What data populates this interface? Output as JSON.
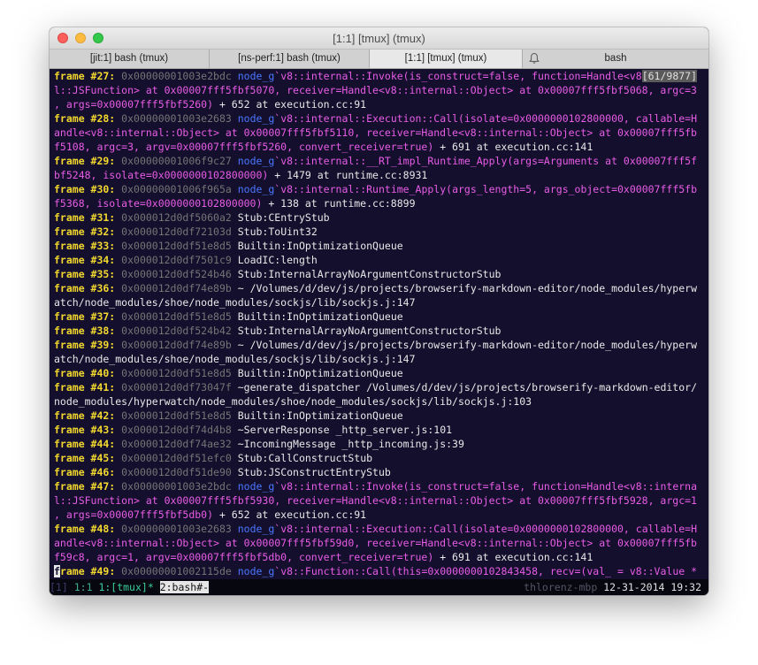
{
  "window": {
    "title": "[1:1] [tmux] (tmux)"
  },
  "tabs": [
    {
      "label": "[jit:1] bash (tmux)"
    },
    {
      "label": "[ns-perf:1] bash (tmux)"
    },
    {
      "label": "[1:1] [tmux] (tmux)"
    },
    {
      "label": "bash",
      "icon": "bell-icon"
    }
  ],
  "terminal": {
    "scroll_position": "[61/9877]",
    "lines": [
      [
        [
          "frame #27:",
          "lbl"
        ],
        [
          " 0x00000001003e2bdc ",
          "addr"
        ],
        [
          "node_g",
          "nodeg"
        ],
        [
          "`v8::internal::Invoke(is_construct=false, function=Handle<v8",
          "pink"
        ]
      ],
      [
        [
          "l::JSFunction> at 0x00007fff5fbf5070, receiver=Handle<v8::internal::Object> at 0x00007fff5fbf5068, argc=3",
          "pink"
        ]
      ],
      [
        [
          ", args=0x00007fff5fbf5260)",
          "pink"
        ],
        [
          " + 652 at execution.cc:91",
          "plain"
        ]
      ],
      [
        [
          "frame #28:",
          "lbl"
        ],
        [
          " 0x00000001003e2683 ",
          "addr"
        ],
        [
          "node_g",
          "nodeg"
        ],
        [
          "`v8::internal::Execution::Call(isolate=0x0000000102800000, callable=H",
          "pink"
        ]
      ],
      [
        [
          "andle<v8::internal::Object> at 0x00007fff5fbf5110, receiver=Handle<v8::internal::Object> at 0x00007fff5fb",
          "pink"
        ]
      ],
      [
        [
          "f5108, argc=3, argv=0x00007fff5fbf5260, convert_receiver=true)",
          "pink"
        ],
        [
          " + 691 at execution.cc:141",
          "plain"
        ]
      ],
      [
        [
          "frame #29:",
          "lbl"
        ],
        [
          " 0x00000001006f9c27 ",
          "addr"
        ],
        [
          "node_g",
          "nodeg"
        ],
        [
          "`v8::internal::__RT_impl_Runtime_Apply(args=Arguments at 0x00007fff5f",
          "pink"
        ]
      ],
      [
        [
          "bf5248, isolate=0x0000000102800000)",
          "pink"
        ],
        [
          " + 1479 at runtime.cc:8931",
          "plain"
        ]
      ],
      [
        [
          "frame #30:",
          "lbl"
        ],
        [
          " 0x00000001006f965a ",
          "addr"
        ],
        [
          "node_g",
          "nodeg"
        ],
        [
          "`v8::internal::Runtime_Apply(args_length=5, args_object=0x00007fff5fb",
          "pink"
        ]
      ],
      [
        [
          "f5368, isolate=0x0000000102800000)",
          "pink"
        ],
        [
          " + 138 at runtime.cc:8899",
          "plain"
        ]
      ],
      [
        [
          "frame #31:",
          "lbl"
        ],
        [
          " 0x000012d0df5060a2 ",
          "addr"
        ],
        [
          "Stub:CEntryStub",
          "plain"
        ]
      ],
      [
        [
          "frame #32:",
          "lbl"
        ],
        [
          " 0x000012d0df72103d ",
          "addr"
        ],
        [
          "Stub:ToUint32",
          "plain"
        ]
      ],
      [
        [
          "frame #33:",
          "lbl"
        ],
        [
          " 0x000012d0df51e8d5 ",
          "addr"
        ],
        [
          "Builtin:InOptimizationQueue",
          "plain"
        ]
      ],
      [
        [
          "frame #34:",
          "lbl"
        ],
        [
          " 0x000012d0df7501c9 ",
          "addr"
        ],
        [
          "LoadIC:length",
          "plain"
        ]
      ],
      [
        [
          "frame #35:",
          "lbl"
        ],
        [
          " 0x000012d0df524b46 ",
          "addr"
        ],
        [
          "Stub:InternalArrayNoArgumentConstructorStub",
          "plain"
        ]
      ],
      [
        [
          "frame #36:",
          "lbl"
        ],
        [
          " 0x000012d0df74e89b ",
          "addr"
        ],
        [
          "~ /Volumes/d/dev/js/projects/browserify-markdown-editor/node_modules/hyperw",
          "plain"
        ]
      ],
      [
        [
          "atch/node_modules/shoe/node_modules/sockjs/lib/sockjs.j:147",
          "plain"
        ]
      ],
      [
        [
          "frame #37:",
          "lbl"
        ],
        [
          " 0x000012d0df51e8d5 ",
          "addr"
        ],
        [
          "Builtin:InOptimizationQueue",
          "plain"
        ]
      ],
      [
        [
          "frame #38:",
          "lbl"
        ],
        [
          " 0x000012d0df524b42 ",
          "addr"
        ],
        [
          "Stub:InternalArrayNoArgumentConstructorStub",
          "plain"
        ]
      ],
      [
        [
          "frame #39:",
          "lbl"
        ],
        [
          " 0x000012d0df74e89b ",
          "addr"
        ],
        [
          "~ /Volumes/d/dev/js/projects/browserify-markdown-editor/node_modules/hyperw",
          "plain"
        ]
      ],
      [
        [
          "atch/node_modules/shoe/node_modules/sockjs/lib/sockjs.j:147",
          "plain"
        ]
      ],
      [
        [
          "frame #40:",
          "lbl"
        ],
        [
          " 0x000012d0df51e8d5 ",
          "addr"
        ],
        [
          "Builtin:InOptimizationQueue",
          "plain"
        ]
      ],
      [
        [
          "frame #41:",
          "lbl"
        ],
        [
          " 0x000012d0df73047f ",
          "addr"
        ],
        [
          "~generate_dispatcher /Volumes/d/dev/js/projects/browserify-markdown-editor/",
          "plain"
        ]
      ],
      [
        [
          "node_modules/hyperwatch/node_modules/shoe/node_modules/sockjs/lib/sockjs.j:103",
          "plain"
        ]
      ],
      [
        [
          "frame #42:",
          "lbl"
        ],
        [
          " 0x000012d0df51e8d5 ",
          "addr"
        ],
        [
          "Builtin:InOptimizationQueue",
          "plain"
        ]
      ],
      [
        [
          "frame #43:",
          "lbl"
        ],
        [
          " 0x000012d0df74d4b8 ",
          "addr"
        ],
        [
          "~ServerResponse _http_server.js:101",
          "plain"
        ]
      ],
      [
        [
          "frame #44:",
          "lbl"
        ],
        [
          " 0x000012d0df74ae32 ",
          "addr"
        ],
        [
          "~IncomingMessage _http_incoming.js:39",
          "plain"
        ]
      ],
      [
        [
          "frame #45:",
          "lbl"
        ],
        [
          " 0x000012d0df51efc0 ",
          "addr"
        ],
        [
          "Stub:CallConstructStub",
          "plain"
        ]
      ],
      [
        [
          "frame #46:",
          "lbl"
        ],
        [
          " 0x000012d0df51de90 ",
          "addr"
        ],
        [
          "Stub:JSConstructEntryStub",
          "plain"
        ]
      ],
      [
        [
          "frame #47:",
          "lbl"
        ],
        [
          " 0x00000001003e2bdc ",
          "addr"
        ],
        [
          "node_g",
          "nodeg"
        ],
        [
          "`v8::internal::Invoke(is_construct=false, function=Handle<v8::interna",
          "pink"
        ]
      ],
      [
        [
          "l::JSFunction> at 0x00007fff5fbf5930, receiver=Handle<v8::internal::Object> at 0x00007fff5fbf5928, argc=1",
          "pink"
        ]
      ],
      [
        [
          ", args=0x00007fff5fbf5db0)",
          "pink"
        ],
        [
          " + 652 at execution.cc:91",
          "plain"
        ]
      ],
      [
        [
          "frame #48:",
          "lbl"
        ],
        [
          " 0x00000001003e2683 ",
          "addr"
        ],
        [
          "node_g",
          "nodeg"
        ],
        [
          "`v8::internal::Execution::Call(isolate=0x0000000102800000, callable=H",
          "pink"
        ]
      ],
      [
        [
          "andle<v8::internal::Object> at 0x00007fff5fbf59d0, receiver=Handle<v8::internal::Object> at 0x00007fff5fb",
          "pink"
        ]
      ],
      [
        [
          "f59c8, argc=1, argv=0x00007fff5fbf5db0, convert_receiver=true)",
          "pink"
        ],
        [
          " + 691 at execution.cc:141",
          "plain"
        ]
      ],
      [
        [
          "f",
          "lbl cursor"
        ],
        [
          "rame #49:",
          "lbl"
        ],
        [
          " 0x00000001002115de ",
          "addr"
        ],
        [
          "node_g",
          "nodeg"
        ],
        [
          "`v8::Function::Call(this=0x0000000102843458, recv=(val_ = v8::Value *",
          "pink"
        ]
      ]
    ]
  },
  "status_bar": {
    "session": "[1]",
    "pane": "1:1",
    "window_1": "1:[tmux]*",
    "window_2": "2:bash#-",
    "host": "thlorenz-mbp",
    "date": "12-31-2014",
    "time": "19:32"
  },
  "colors": {
    "terminal_bg": "#140f2d",
    "frame_label": "#f3d92f",
    "address": "#757575",
    "node_g": "#4a78ff",
    "cpp_text": "#e95ce6"
  }
}
